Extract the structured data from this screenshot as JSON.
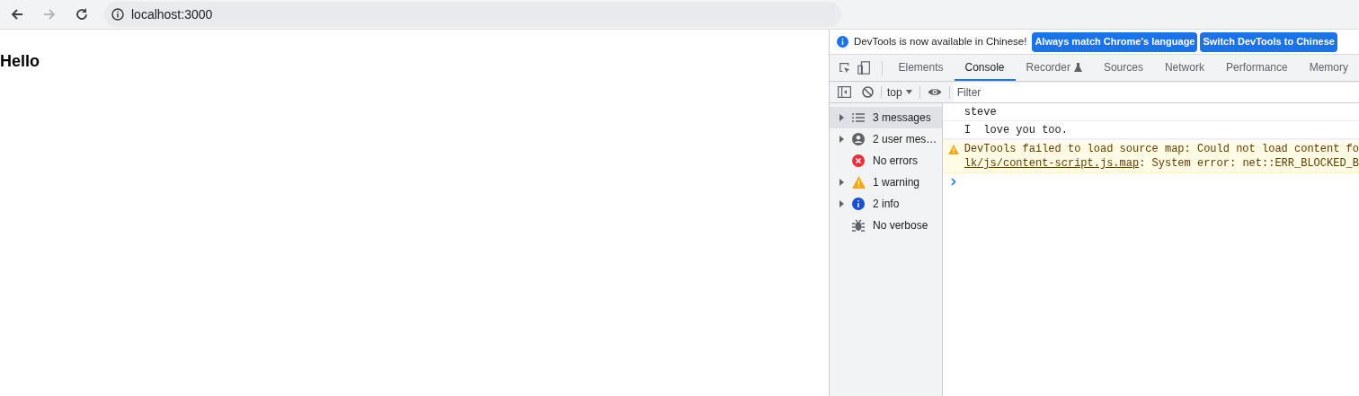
{
  "browser": {
    "nav": [
      {
        "kind": "back",
        "disabled": false
      },
      {
        "kind": "forward",
        "disabled": true
      },
      {
        "kind": "reload",
        "disabled": false
      }
    ],
    "url": "localhost:3000"
  },
  "page": {
    "heading": "Hello"
  },
  "devtools": {
    "infobar": {
      "message": "DevTools is now available in Chinese!",
      "buttons": [
        "Always match Chrome's language",
        "Switch DevTools to Chinese"
      ]
    },
    "tabs": [
      {
        "label": "Elements",
        "selected": false
      },
      {
        "label": "Console",
        "selected": true
      },
      {
        "label": "Recorder",
        "selected": false,
        "experimental": true
      },
      {
        "label": "Sources",
        "selected": false
      },
      {
        "label": "Network",
        "selected": false
      },
      {
        "label": "Performance",
        "selected": false
      },
      {
        "label": "Memory",
        "selected": false
      }
    ],
    "console_toolbar": {
      "context": "top",
      "filter_placeholder": "Filter"
    },
    "sidebar": [
      {
        "kind": "messages",
        "label": "3 messages",
        "expandable": true,
        "selected": true
      },
      {
        "kind": "user",
        "label": "2 user mes…",
        "expandable": true,
        "selected": false
      },
      {
        "kind": "error",
        "label": "No errors",
        "expandable": false,
        "selected": false
      },
      {
        "kind": "warning",
        "label": "1 warning",
        "expandable": true,
        "selected": false
      },
      {
        "kind": "info",
        "label": "2 info",
        "expandable": true,
        "selected": false
      },
      {
        "kind": "verbose",
        "label": "No verbose",
        "expandable": false,
        "selected": false
      }
    ],
    "messages": [
      {
        "kind": "log",
        "text": "steve"
      },
      {
        "kind": "log",
        "text": "I  love you too."
      },
      {
        "kind": "warning",
        "text": "DevTools failed to load source map: Could not load content fo",
        "link": "lk/js/content-script.js.map",
        "text_after": ": System error: net::ERR_BLOCKED_B"
      }
    ]
  }
}
